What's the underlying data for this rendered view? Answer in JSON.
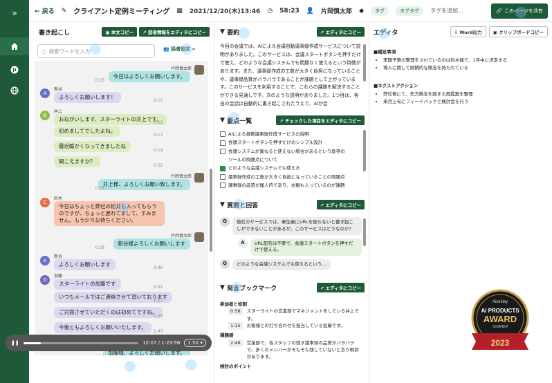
{
  "topbar": {
    "back": "戻る",
    "title": "クライアント定例ミーティング",
    "datetime": "2021/12/20(木)13:46",
    "duration": "58:23",
    "owner": "片岡慎太郎",
    "tags": [
      "タグ",
      "タグタグ"
    ],
    "add_tag": "タグを追加...",
    "share": "このページを共有"
  },
  "transcript": {
    "title": "書き起こし",
    "copy_body": "本文コピー",
    "copy_speaker": "話者情報をエディタにコピー",
    "search_placeholder": "検索ワードを入力",
    "speaker_settings": "話者設定",
    "messages": [
      {
        "speaker": "片岡慎太郎",
        "text": "今日はよろしくお願いします。",
        "time": "0:15",
        "side": "right",
        "color": "teal"
      },
      {
        "speaker": "新谷",
        "text": "よろしくお願いします！",
        "time": "0:15",
        "side": "left",
        "color": "lav",
        "initial": "A"
      },
      {
        "speaker": "井上",
        "text": "おねがいします、スターライトの井上です。",
        "time": "0:15",
        "side": "left",
        "color": "green",
        "initial": "B"
      },
      {
        "text": "初めましてでしたよね。",
        "time": "0:17",
        "side": "left",
        "color": "green"
      },
      {
        "text": "最近暖かくなってきましたね",
        "time": "0:19",
        "side": "left",
        "color": "green"
      },
      {
        "text": "聞こえますか？",
        "time": "0:22",
        "side": "left",
        "color": "green"
      },
      {
        "speaker": "片岡慎太郎",
        "text": "井上様、よろしくお願い致します。",
        "time": "0:25",
        "side": "right",
        "color": "teal"
      },
      {
        "speaker": "鈴木",
        "text": "今日はちょっと弊社の松井も入ってもらうのですが、ちょっと遅れてまして、すみません。もう少々お待ちください。",
        "time": "0:31",
        "side": "left",
        "color": "salmon",
        "initial": "C"
      },
      {
        "speaker": "片岡慎太郎",
        "text": "新谷様よろしくお願いします",
        "time": "0:39",
        "side": "right",
        "color": "teal"
      },
      {
        "speaker": "新谷",
        "text": "よろしくお願いします",
        "time": "0:46",
        "side": "left",
        "color": "lav",
        "initial": "A"
      },
      {
        "speaker": "加藤",
        "text": "スターライトの加藤です",
        "time": "0:52",
        "side": "left",
        "color": "lav",
        "initial": "D"
      },
      {
        "text": "いつもメールではご連絡させて頂いております",
        "time": "1:17",
        "side": "left",
        "color": "lav"
      },
      {
        "text": "ご対面させていただくのは初めてですね。",
        "time": "1:25",
        "side": "left",
        "color": "lav"
      },
      {
        "text": "今後ともよろしくお願いいたします。",
        "time": "1:43",
        "side": "left",
        "color": "lav"
      },
      {
        "speaker": "片岡慎太郎",
        "text": "加藤様、よろしくお願いします。",
        "time": "1:50",
        "side": "right",
        "color": "teal"
      }
    ]
  },
  "player": {
    "time": "12:07 / 1:23:56",
    "speed": "1.5X",
    "progress": 0.15
  },
  "summary": {
    "title": "要約",
    "copy": "エディタにコピー",
    "text": "今回の会議では、AIによる会議自動議事録作成サービスについて説明がありました。このサービスは、会議スタートボタンを押すだけで使え、どのような会議システムでも問題なく使えるという特徴があります。また、議事録作成の工数が大きく負担になっていることや、議事録品質がバラバラであることが課題として上がっています。このサービスを利用することで、これらの課題を解決することができる見通しです。次のような説明がありました。1つ目は、各自の会話は自動的に書き起こされたうえで、AIが会"
  },
  "keypoints": {
    "title": "要点一覧",
    "copy": "チェックした項目をエディタにコピー",
    "items": [
      {
        "text": "AIによる自動議事録作成サービスの説明",
        "checked": false
      },
      {
        "text": "会議スタートボタンを押すだけのシンプル設計",
        "checked": false
      },
      {
        "text": "会議システムが異なると使えない場合があるという既存の",
        "checked": false
      },
      {
        "text": "ツールの問題点について",
        "checked": null
      },
      {
        "text": "どのような会議システムでも使える",
        "checked": true
      },
      {
        "text": "議事録作成の工数が大きく負担になっていることの問題点",
        "checked": false
      },
      {
        "text": "議事録の品質が属人的であり、主観も入っているのが課題",
        "checked": false
      }
    ]
  },
  "qa": {
    "title": "質問と回答",
    "copy": "エディタにコピー",
    "items": [
      {
        "type": "Q",
        "text": "他社のサービスでは、参加者にURLを配らないと書き起こしができないことがあるが、このサービスはどうなのか？"
      },
      {
        "type": "A",
        "text": "URL配布は不要で、会議スタートボタンを押すだけで使える。"
      },
      {
        "type": "Q",
        "text": "どのような会議システムでも使えるという…"
      }
    ]
  },
  "bookmarks": {
    "title": "発言ブックマーク",
    "copy": "エディタにコピー",
    "groups": [
      {
        "heading": "参加者と役割",
        "rows": [
          {
            "t": "0:58",
            "text": "スターライトの営業部でマネジメントをしている井上です。"
          },
          {
            "t": "1:15",
            "text": "お客様との打ち合わせを担当している加藤です。"
          }
        ]
      },
      {
        "heading": "課題感",
        "rows": [
          {
            "t": "2:46",
            "text": "営業部で、各スタッフの残す議事録の品質がバラバラで、多くのメンバーがそもそも残していないと言う現状があります。"
          }
        ]
      },
      {
        "heading": "検討のポイント",
        "rows": []
      }
    ]
  },
  "editor": {
    "title": "エディタ",
    "word": "Word出力",
    "clip": "クリップボードコピー",
    "sections": [
      {
        "heading": "■補足事項",
        "items": [
          "来期予算の整理をされているのは鈴木様で、1月中に決定する",
          "導入に関して納期的な懸念を持たれている"
        ]
      },
      {
        "heading": "■ネクストアクション",
        "items": [
          "弊社側にて、先方懸念を踏まえ再提案を整理",
          "来月上旬にフィードバックと検討会を行う"
        ]
      }
    ]
  },
  "award": {
    "brand": "Aismiley",
    "line1": "AI PRODUCTS",
    "line2": "AWARD",
    "line3": "SUMMER",
    "year": "2023"
  },
  "colors": {
    "brand": "#1e5a3a",
    "teal": "#aee3e3",
    "lav": "#ddd8f0",
    "green": "#dcedc2",
    "salmon": "#f7c5ae"
  }
}
